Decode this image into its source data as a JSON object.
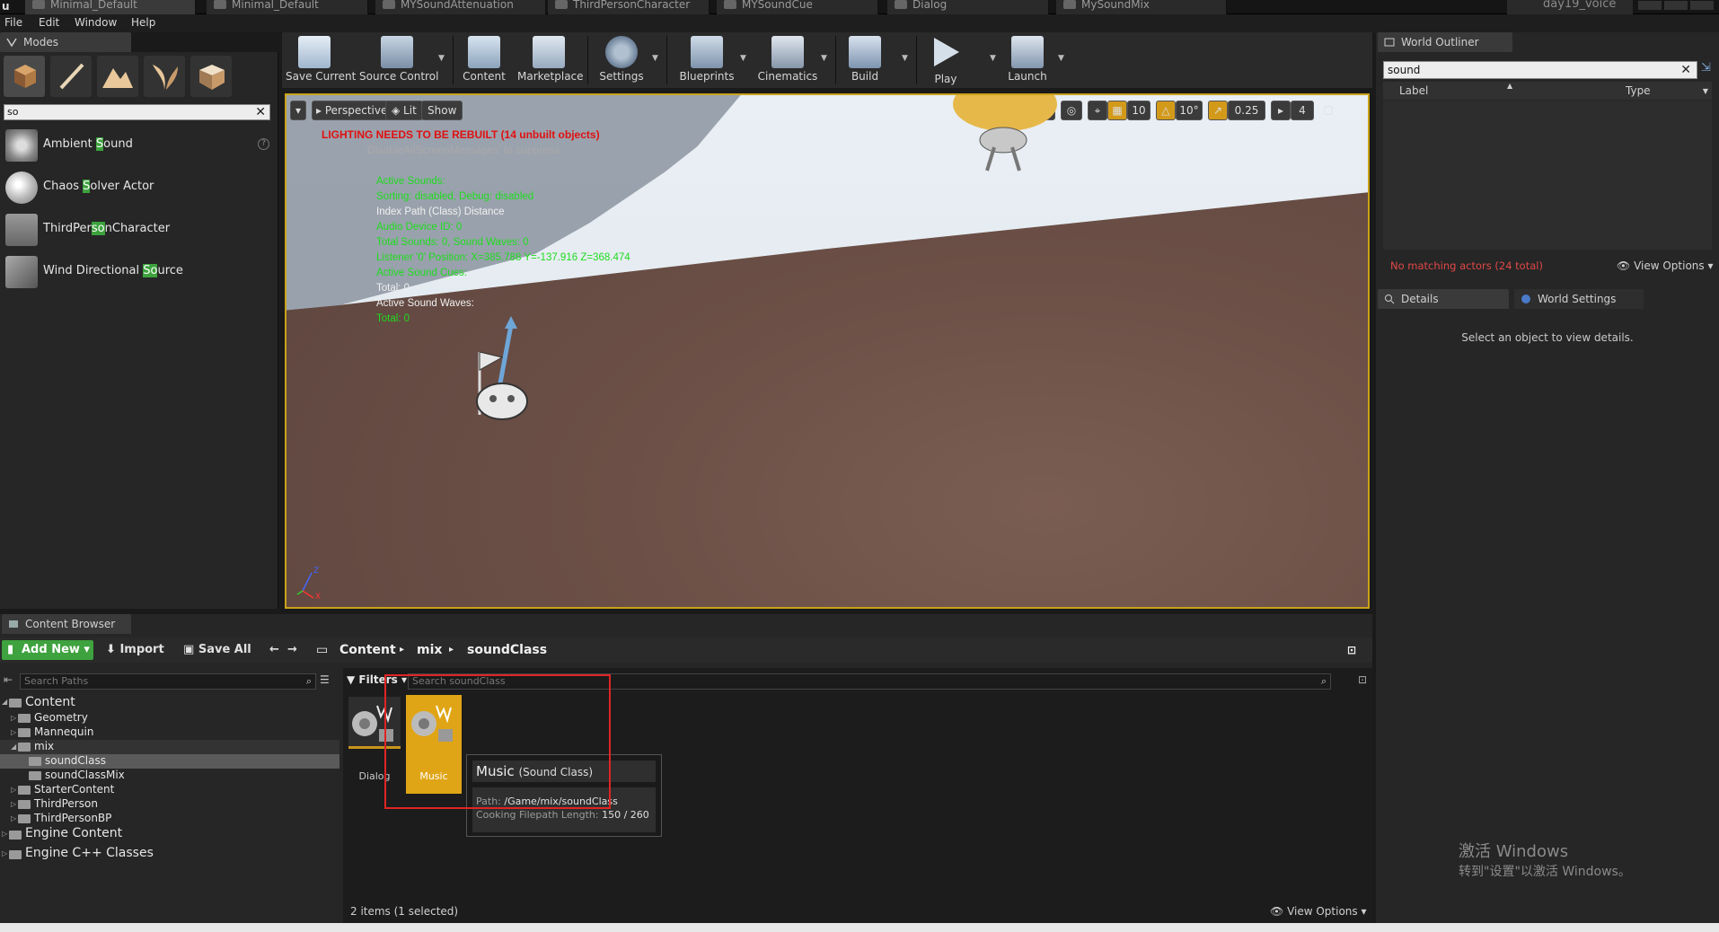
{
  "tabs": [
    {
      "label": "Minimal_Default"
    },
    {
      "label": "Minimal_Default"
    },
    {
      "label": "MYSoundAttenuation"
    },
    {
      "label": "ThirdPersonCharacter"
    },
    {
      "label": "MYSoundCue"
    },
    {
      "label": "Dialog"
    },
    {
      "label": "MySoundMix"
    }
  ],
  "project_name": "day19_voice",
  "menu": [
    "File",
    "Edit",
    "Window",
    "Help"
  ],
  "modes": {
    "tab_label": "Modes",
    "search_value": "so",
    "items": [
      {
        "pre": "Ambient ",
        "hl": "S",
        "post": "ound"
      },
      {
        "pre": "Chaos ",
        "hl": "S",
        "post": "olver Actor"
      },
      {
        "pre": "ThirdPer",
        "hl": "so",
        "post": "nCharacter"
      },
      {
        "pre": "Wind Directional ",
        "hl": "So",
        "post": "urce"
      }
    ]
  },
  "toolbar": {
    "buttons": [
      "Save Current",
      "Source Control",
      "Content",
      "Marketplace",
      "Settings",
      "Blueprints",
      "Cinematics",
      "Build",
      "Play",
      "Launch"
    ]
  },
  "viewport": {
    "perspective_label": "Perspective",
    "lit_label": "Lit",
    "show_label": "Show",
    "grid_snap": "10",
    "rot_snap": "10°",
    "scale_snap": "0.25",
    "cam_speed": "4",
    "lighting_warning": "LIGHTING NEEDS TO BE REBUILT (14 unbuilt objects)",
    "suppress_msg": "'DisableAllScreenMessages' to suppress",
    "stats": [
      {
        "text": "Active Sounds:",
        "color": "g"
      },
      {
        "text": " Sorting: disabled, Debug: disabled",
        "color": "g"
      },
      {
        "text": "Index Path (Class) Distance",
        "color": "w"
      },
      {
        "text": "Audio Device ID: 0",
        "color": "g"
      },
      {
        "text": "Total Sounds: 0, Sound Waves: 0",
        "color": "g"
      },
      {
        "text": "Listener '0' Position: X=385.788 Y=-137.916 Z=368.474",
        "color": "g"
      },
      {
        "text": "Active Sound Cues:",
        "color": "g"
      },
      {
        "text": "Total: 0",
        "color": "w"
      },
      {
        "text": "Active Sound Waves:",
        "color": "w"
      },
      {
        "text": " Total: 0",
        "color": "g"
      }
    ]
  },
  "outliner": {
    "tab_label": "World Outliner",
    "search_value": "sound",
    "col_label": "Label",
    "col_type": "Type",
    "no_match": "No matching actors (24 total)",
    "view_options": "View Options"
  },
  "details": {
    "tab_label": "Details",
    "world_settings_label": "World Settings",
    "empty_msg": "Select an object to view details."
  },
  "windows_activation": {
    "line1": "激活 Windows",
    "line2": "转到\"设置\"以激活 Windows。"
  },
  "content_browser": {
    "tab_label": "Content Browser",
    "add_new": "Add New",
    "import": "Import",
    "save_all": "Save All",
    "crumbs": [
      "Content",
      "mix",
      "soundClass"
    ],
    "path_search_placeholder": "Search Paths",
    "filters_label": "Filters",
    "asset_search_placeholder": "Search soundClass",
    "tree": [
      {
        "label": "Content",
        "level": 0,
        "big": true
      },
      {
        "label": "Geometry",
        "level": 1
      },
      {
        "label": "Mannequin",
        "level": 1
      },
      {
        "label": "mix",
        "level": 1
      },
      {
        "label": "soundClass",
        "level": 2,
        "selected": true
      },
      {
        "label": "soundClassMix",
        "level": 2
      },
      {
        "label": "StarterContent",
        "level": 1
      },
      {
        "label": "ThirdPerson",
        "level": 1
      },
      {
        "label": "ThirdPersonBP",
        "level": 1
      },
      {
        "label": "Engine Content",
        "level": 0,
        "big": true
      },
      {
        "label": "Engine C++ Classes",
        "level": 0,
        "big": true
      }
    ],
    "assets": [
      {
        "name": "Dialog",
        "selected": false
      },
      {
        "name": "Music",
        "selected": true
      }
    ],
    "tooltip": {
      "title": "Music",
      "type": "(Sound Class)",
      "path_label": "Path:",
      "path_value": "/Game/mix/soundClass",
      "cooking_label": "Cooking Filepath Length:",
      "cooking_value": "150 / 260"
    },
    "items_count": "2 items (1 selected)",
    "view_options": "View Options"
  },
  "colors": {
    "accent_gold": "#e0a516",
    "add_new_green": "#3ea23e",
    "warning_red": "#e01010",
    "stat_green": "#1edc1e"
  }
}
